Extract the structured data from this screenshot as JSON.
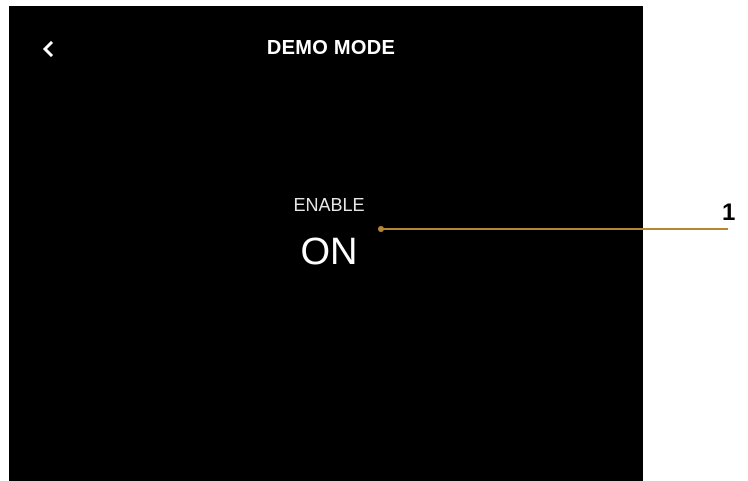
{
  "header": {
    "title": "DEMO MODE",
    "back_icon": "chevron-left-icon"
  },
  "setting": {
    "label": "ENABLE",
    "value": "ON"
  },
  "callout": {
    "number": "1",
    "color": "#b8862e"
  }
}
